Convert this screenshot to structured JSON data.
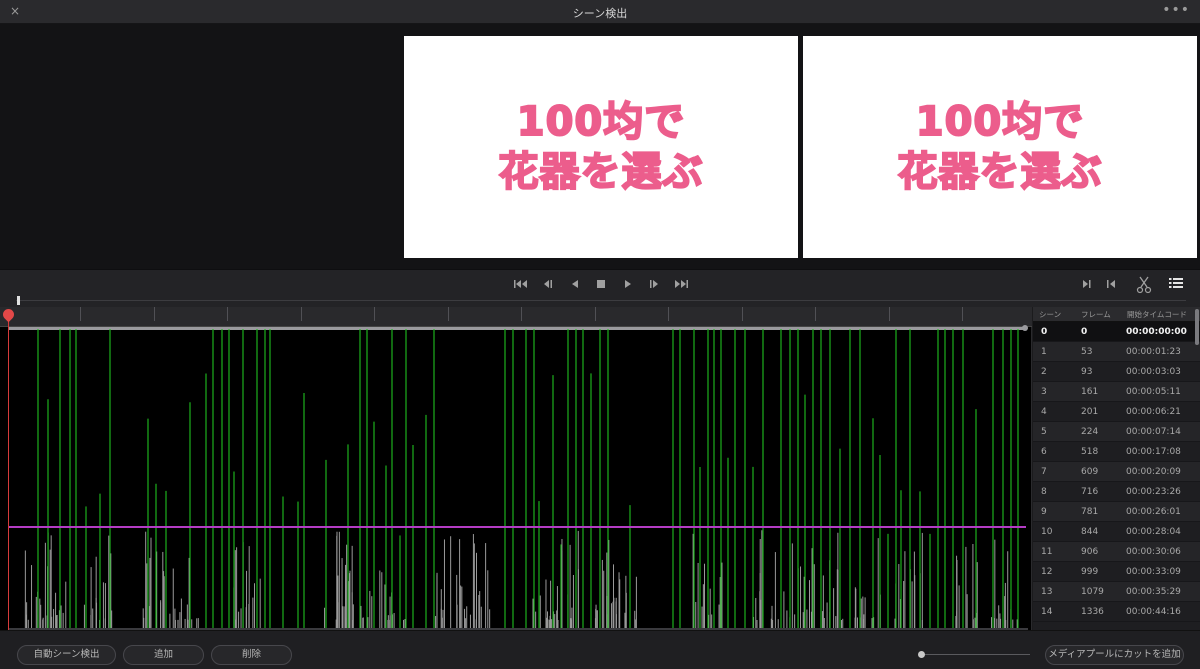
{
  "window": {
    "title": "シーン検出",
    "close_glyph": "×",
    "more_glyph": "•••"
  },
  "preview": {
    "frames": [
      {
        "line1": "100均で",
        "line2": "花器を選ぶ"
      },
      {
        "line1": "100均で",
        "line2": "花器を選ぶ"
      }
    ]
  },
  "transport": {
    "icons": [
      "skip-to-start-icon",
      "step-back-icon",
      "play-reverse-icon",
      "stop-icon",
      "play-icon",
      "step-forward-icon",
      "skip-to-end-icon",
      "mark-in-icon",
      "mark-out-icon",
      "cut-icon",
      "list-view-icon"
    ]
  },
  "colors": {
    "scene_cut_line": "#1fbf1f",
    "histogram": "#9a9a9a",
    "threshold": "#b43cc4",
    "playhead": "#e24848"
  },
  "scene_table": {
    "headers": [
      "シーン",
      "フレーム",
      "開始タイムコード"
    ],
    "selected_index": 0,
    "rows": [
      [
        "0",
        "0",
        "00:00:00:00"
      ],
      [
        "1",
        "53",
        "00:00:01:23"
      ],
      [
        "2",
        "93",
        "00:00:03:03"
      ],
      [
        "3",
        "161",
        "00:00:05:11"
      ],
      [
        "4",
        "201",
        "00:00:06:21"
      ],
      [
        "5",
        "224",
        "00:00:07:14"
      ],
      [
        "6",
        "518",
        "00:00:17:08"
      ],
      [
        "7",
        "609",
        "00:00:20:09"
      ],
      [
        "8",
        "716",
        "00:00:23:26"
      ],
      [
        "9",
        "781",
        "00:00:26:01"
      ],
      [
        "10",
        "844",
        "00:00:28:04"
      ],
      [
        "11",
        "906",
        "00:00:30:06"
      ],
      [
        "12",
        "999",
        "00:00:33:09"
      ],
      [
        "13",
        "1079",
        "00:00:35:29"
      ],
      [
        "14",
        "1336",
        "00:00:44:16"
      ]
    ]
  },
  "footer": {
    "auto_detect_label": "自動シーン検出",
    "add_label": "追加",
    "delete_label": "削除",
    "add_to_media_pool_label": "メディアプールにカットを追加"
  }
}
